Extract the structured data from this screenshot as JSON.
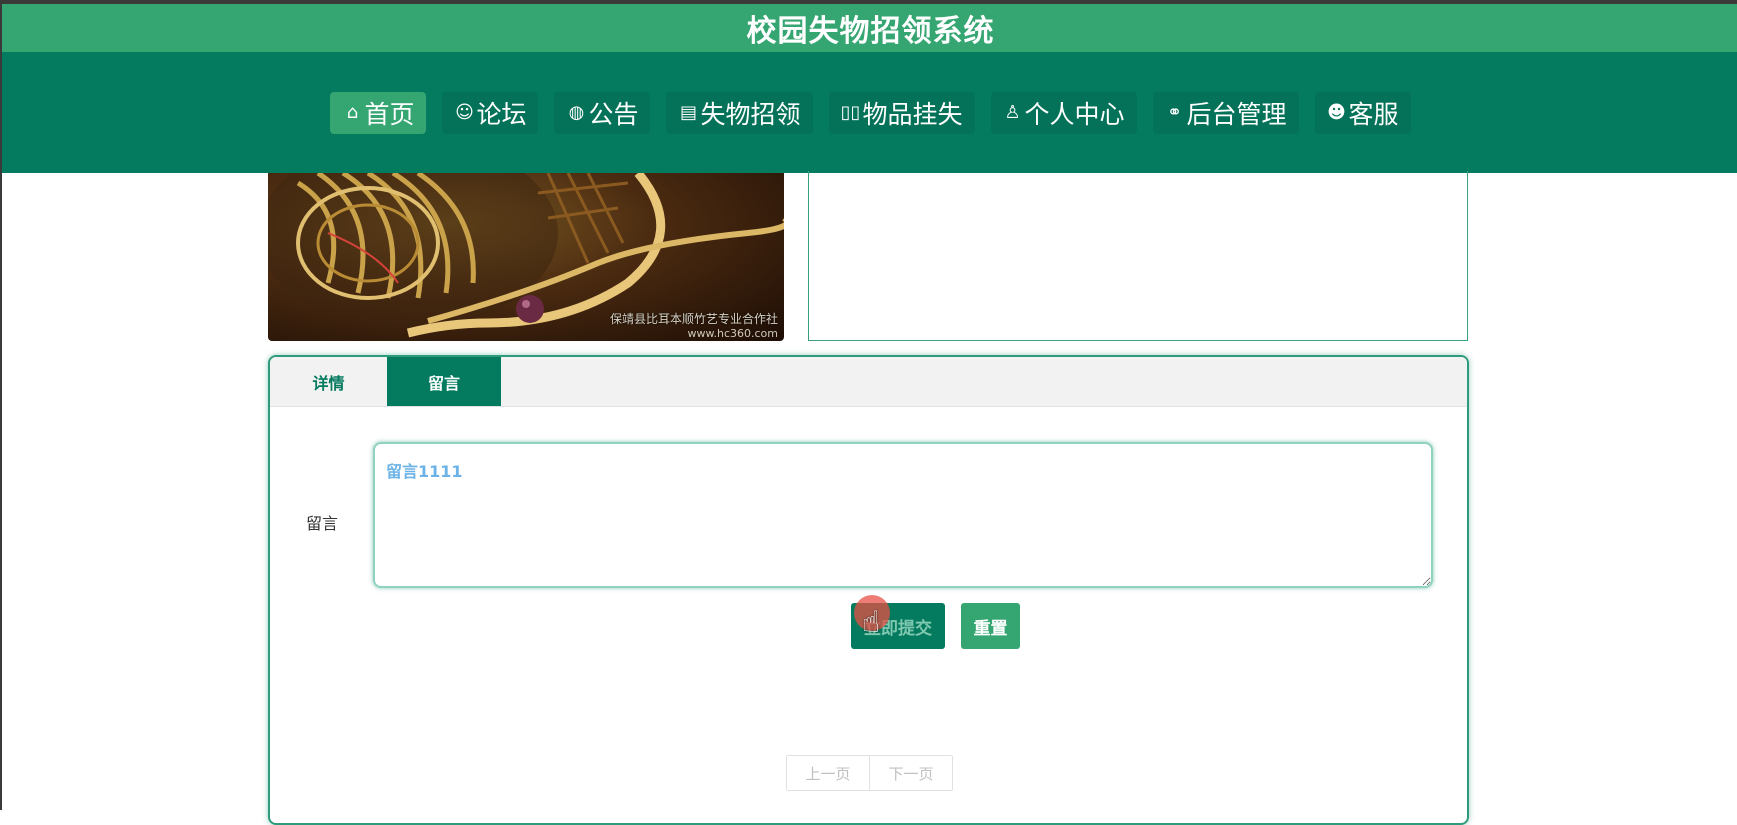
{
  "header": {
    "title": "校园失物招领系统"
  },
  "nav": {
    "items": [
      {
        "label": "首页",
        "icon": "home-icon",
        "glyph": "⌂",
        "active": true
      },
      {
        "label": "论坛",
        "icon": "forum-icon",
        "glyph": "☺",
        "active": false
      },
      {
        "label": "公告",
        "icon": "globe-icon",
        "glyph": "◍",
        "active": false
      },
      {
        "label": "失物招领",
        "icon": "clipboard-icon",
        "glyph": "▤",
        "active": false
      },
      {
        "label": "物品挂失",
        "icon": "report-icon",
        "glyph": "▯▯",
        "active": false
      },
      {
        "label": "个人中心",
        "icon": "user-icon",
        "glyph": "♙",
        "active": false
      },
      {
        "label": "后台管理",
        "icon": "link-icon",
        "glyph": "⚭",
        "active": false
      },
      {
        "label": "客服",
        "icon": "chat-icon",
        "glyph": "☻",
        "active": false
      }
    ]
  },
  "photo": {
    "watermark": "保靖县比耳本顺竹艺专业合作社",
    "watermark_url": "www.hc360.com"
  },
  "tabs": [
    {
      "label": "详情",
      "active": false
    },
    {
      "label": "留言",
      "active": true
    }
  ],
  "comment": {
    "label": "留言",
    "value": "留言1111"
  },
  "buttons": {
    "submit": "立即提交",
    "reset": "重置"
  },
  "pager": {
    "prev": "上一页",
    "next": "下一页"
  },
  "colors": {
    "title_bar": "#35a572",
    "nav_bar": "#047a5e",
    "accent": "#047a5e",
    "active_nav": "#35a572"
  }
}
